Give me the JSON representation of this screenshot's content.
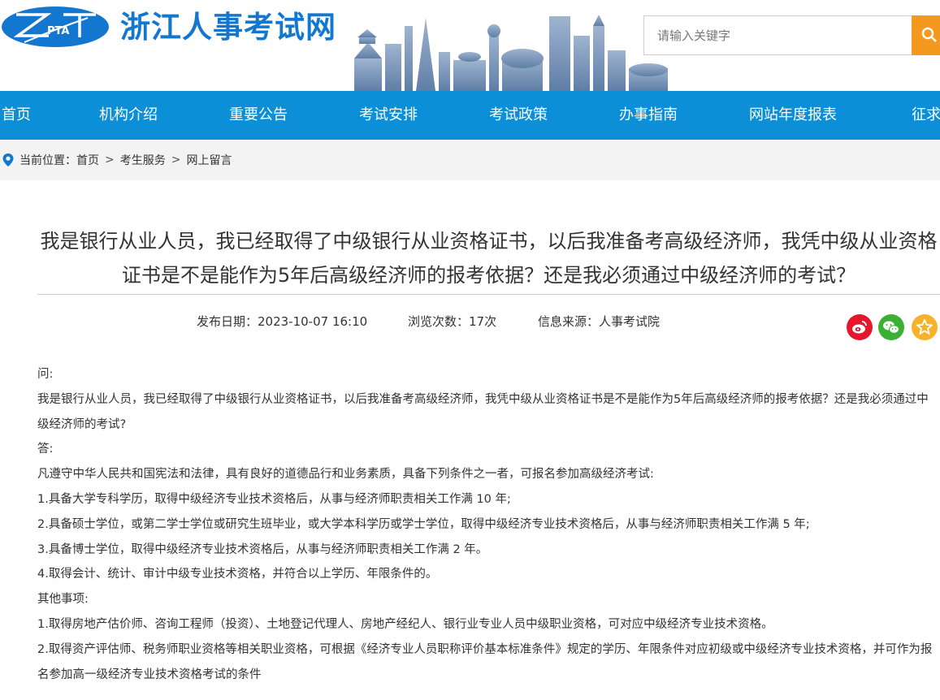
{
  "header": {
    "logo_text": "PTA",
    "site_name": "浙江人事考试网",
    "search_placeholder": "请输入关键字"
  },
  "nav": {
    "items": [
      "首页",
      "机构介绍",
      "重要公告",
      "考试安排",
      "考试政策",
      "办事指南",
      "网站年度报表",
      "征求"
    ]
  },
  "breadcrumb": {
    "prefix": "当前位置：",
    "items": [
      "首页",
      "考生服务",
      "网上留言"
    ],
    "separator": ">"
  },
  "article": {
    "title": "我是银行从业人员，我已经取得了中级银行从业资格证书，以后我准备考高级经济师，我凭中级从业资格证书是不是能作为5年后高级经济师的报考依据？还是我必须通过中级经济师的考试？",
    "publish_date": "发布日期：2023-10-07 16:10",
    "views": "浏览次数：17次",
    "source": "信息来源：人事考试院",
    "paragraphs": [
      "问:",
      "我是银行从业人员，我已经取得了中级银行从业资格证书，以后我准备考高级经济师，我凭中级从业资格证书是不是能作为5年后高级经济师的报考依据？还是我必须通过中级经济师的考试?",
      "答:",
      "凡遵守中华人民共和国宪法和法律，具有良好的道德品行和业务素质，具备下列条件之一者，可报名参加高级经济考试:",
      "1.具备大学专科学历，取得中级经济专业技术资格后，从事与经济师职责相关工作满 10 年;",
      "2.具备硕士学位，或第二学士学位或研究生班毕业，或大学本科学历或学士学位，取得中级经济专业技术资格后，从事与经济师职责相关工作满 5 年;",
      "3.具备博士学位，取得中级经济专业技术资格后，从事与经济师职责相关工作满 2 年。",
      "4.取得会计、统计、审计中级专业技术资格，并符合以上学历、年限条件的。",
      "其他事项:",
      "1.取得房地产估价师、咨询工程师（投资）、土地登记代理人、房地产经纪人、银行业专业人员中级职业资格，可对应中级经济专业技术资格。",
      "2.取得资产评估师、税务师职业资格等相关职业资格，可根据《经济专业人员职称评价基本标准条件》规定的学历、年限条件对应初级或中级经济专业技术资格，并可作为报名参加高一级经济专业技术资格考试的条件"
    ]
  },
  "share": {
    "icons": [
      "weibo-icon",
      "wechat-icon",
      "favorite-star-icon"
    ],
    "colors": [
      "#e6162d",
      "#3cb034",
      "#f6b22a"
    ]
  },
  "colors": {
    "brand_blue": "#1477cf",
    "nav_blue": "#0d8fd8",
    "search_orange": "#f39a1e"
  }
}
